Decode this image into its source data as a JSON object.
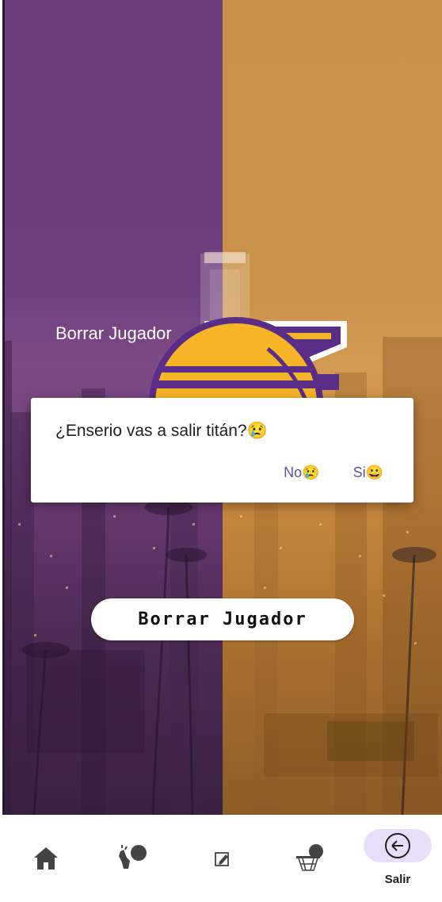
{
  "header": {
    "title": "Borrar Jugador"
  },
  "main": {
    "action_button_label": "Borrar Jugador"
  },
  "dialog": {
    "message": "¿Enserio vas a salir titán?😢",
    "no_label": "No😢",
    "yes_label": "Si😀"
  },
  "bottom_nav": {
    "items": [
      {
        "icon": "home-icon"
      },
      {
        "icon": "hand-ball-icon"
      },
      {
        "icon": "edit-icon"
      },
      {
        "icon": "basketball-hoop-icon"
      },
      {
        "icon": "arrow-left-circle-icon",
        "label": "Salir",
        "active": true
      }
    ]
  },
  "colors": {
    "lakers_purple": "#6b3d7c",
    "lakers_gold": "#c78f48",
    "dialog_button": "#5d52a6",
    "active_pill": "#e9def9"
  }
}
